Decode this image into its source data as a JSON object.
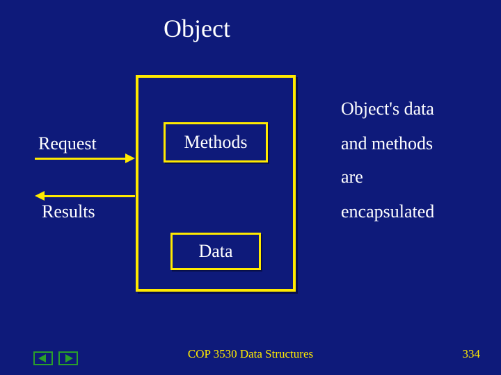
{
  "title": "Object",
  "outer": {
    "methods": "Methods",
    "data": "Data"
  },
  "left": {
    "request": "Request",
    "results": "Results"
  },
  "right": {
    "line1": "Object's data",
    "line2": "and methods",
    "line3": "are",
    "line4": "encapsulated"
  },
  "footer": {
    "course": "COP 3530 Data Structures",
    "page": "334"
  }
}
